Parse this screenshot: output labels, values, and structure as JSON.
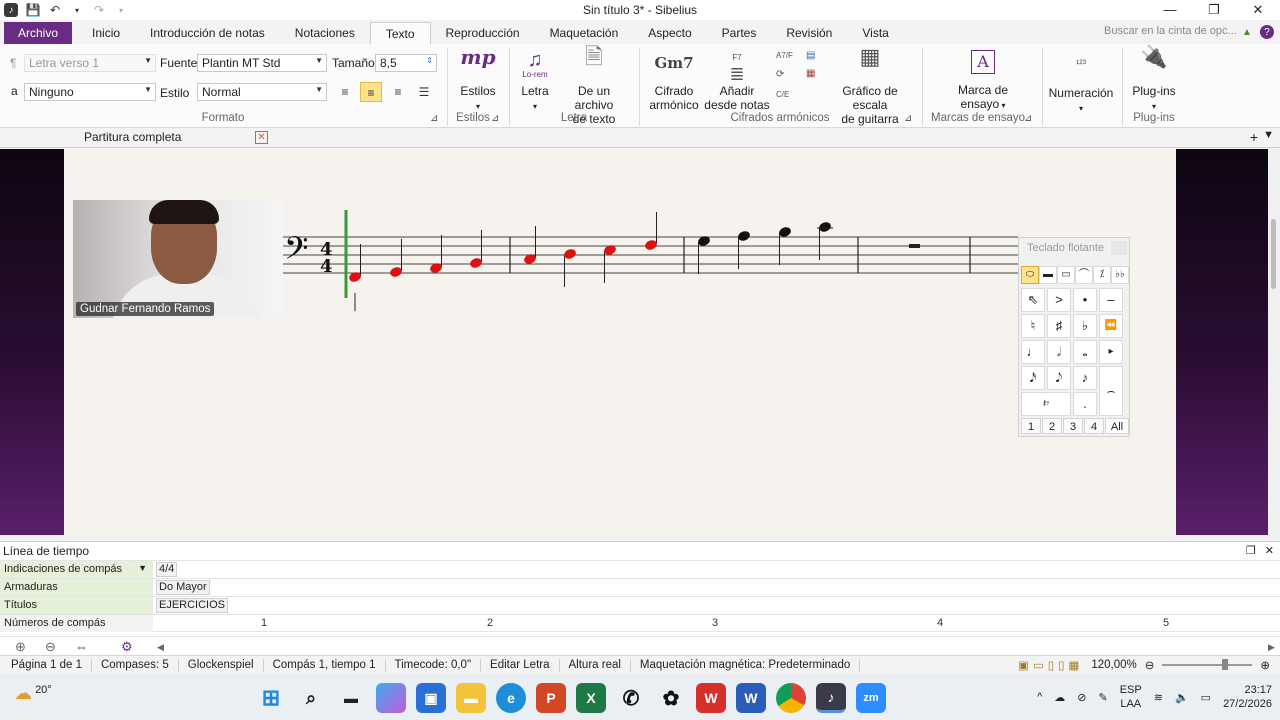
{
  "window": {
    "title": "Sin título 3* - Sibelius",
    "controls": [
      "minimize-icon",
      "restore-icon",
      "close-icon"
    ]
  },
  "ribbon_tabs": [
    "Archivo",
    "Inicio",
    "Introducción de notas",
    "Notaciones",
    "Texto",
    "Reproducción",
    "Maquetación",
    "Aspecto",
    "Partes",
    "Revisión",
    "Vista"
  ],
  "active_tab": "Texto",
  "search": {
    "placeholder": "Buscar en la cinta de opc..."
  },
  "ribbon": {
    "format": {
      "style_category_value": "Letra verso 1",
      "font_label": "Fuente",
      "font_value": "Plantin MT Std",
      "size_label": "Tamaño",
      "size_value": "8,5",
      "second_row_glyph": "a",
      "second_row_value": "Ninguno",
      "style_label": "Estilo",
      "style_value": "Normal",
      "group_label": "Formato"
    },
    "estilos": {
      "button": "Estilos",
      "group_label": "Estilos",
      "icon_text": "mp"
    },
    "letra": {
      "button1": "Letra",
      "icon_text": "Lo-rem",
      "button2_line1": "De un archivo",
      "button2_line2": "de texto",
      "group_label": "Letra"
    },
    "cifrados": {
      "button1_line1": "Cifrado",
      "button1_line2": "armónico",
      "icon_text": "Gm7",
      "button2_line1": "Añadir",
      "button2_line2": "desde notas",
      "button2_icon_text": "F7",
      "button3_line1": "Gráfico de escala",
      "button3_line2": "de guitarra",
      "small_icons": [
        "A7/F",
        "C/E"
      ],
      "group_label": "Cifrados armónicos"
    },
    "marcas": {
      "button_line1": "Marca de",
      "button_line2": "ensayo",
      "icon_text": "A",
      "group_label": "Marcas de ensayo"
    },
    "numeracion": {
      "button": "Numeración"
    },
    "plugins": {
      "button": "Plug-ins",
      "group_label": "Plug-ins"
    }
  },
  "score_tab": {
    "label": "Partitura completa"
  },
  "score": {
    "time_signature": "4/4",
    "clef": "bass-clef",
    "note_color": "#e01010",
    "measure_count": 5
  },
  "webcam": {
    "participant_name": "Gudnar Fernando Ramos"
  },
  "keypad": {
    "title": "Teclado flotante",
    "rows": [
      [
        "⬭",
        "▬",
        "▭",
        "⌒",
        "⁒",
        "♭♭"
      ],
      [
        "⇖",
        ">",
        "•",
        "–"
      ],
      [
        "♮",
        "♯",
        "♭",
        "⏪"
      ],
      [
        "♩",
        "𝅗𝅥",
        "𝅝",
        "▸"
      ],
      [
        "𝅘𝅥𝅯",
        "𝅘𝅥𝅮",
        "♪",
        ""
      ],
      [
        "𝄽𝄾",
        "",
        ".",
        "⌢"
      ]
    ],
    "layouts": [
      "1",
      "2",
      "3",
      "4",
      "All"
    ]
  },
  "timeline": {
    "title": "Línea de tiempo",
    "rows": [
      {
        "label": "Indicaciones de compás",
        "value": "4/4"
      },
      {
        "label": "Armaduras",
        "value": "Do Mayor"
      },
      {
        "label": "Títulos",
        "value": "EJERCICIOS"
      },
      {
        "label": "Números de compás",
        "value": ""
      }
    ],
    "bar_numbers": [
      "1",
      "2",
      "3",
      "4",
      "5"
    ]
  },
  "status_bar": {
    "page": "Página 1 de 1",
    "bars": "Compases: 5",
    "instrument": "Glockenspiel",
    "position": "Compás 1, tiempo 1",
    "timecode": "Timecode: 0,0\"",
    "mode": "Editar Letra",
    "pitch": "Altura real",
    "layout": "Maquetación magnética: Predeterminado",
    "zoom": "120,00%"
  },
  "taskbar": {
    "temperature": "20°",
    "apps": [
      "windows-start-icon",
      "search-icon",
      "file-explorer-icon",
      "copilot-icon",
      "store-icon",
      "folder-icon",
      "edge-icon",
      "powerpoint-icon",
      "excel-icon",
      "whatsapp-icon",
      "chatgpt-icon",
      "wps-icon",
      "word-icon",
      "chrome-icon",
      "sibelius-icon",
      "zoom-icon"
    ],
    "language_line1": "ESP",
    "language_line2": "LAA",
    "time": "23:17",
    "date": "27/2/2026"
  }
}
